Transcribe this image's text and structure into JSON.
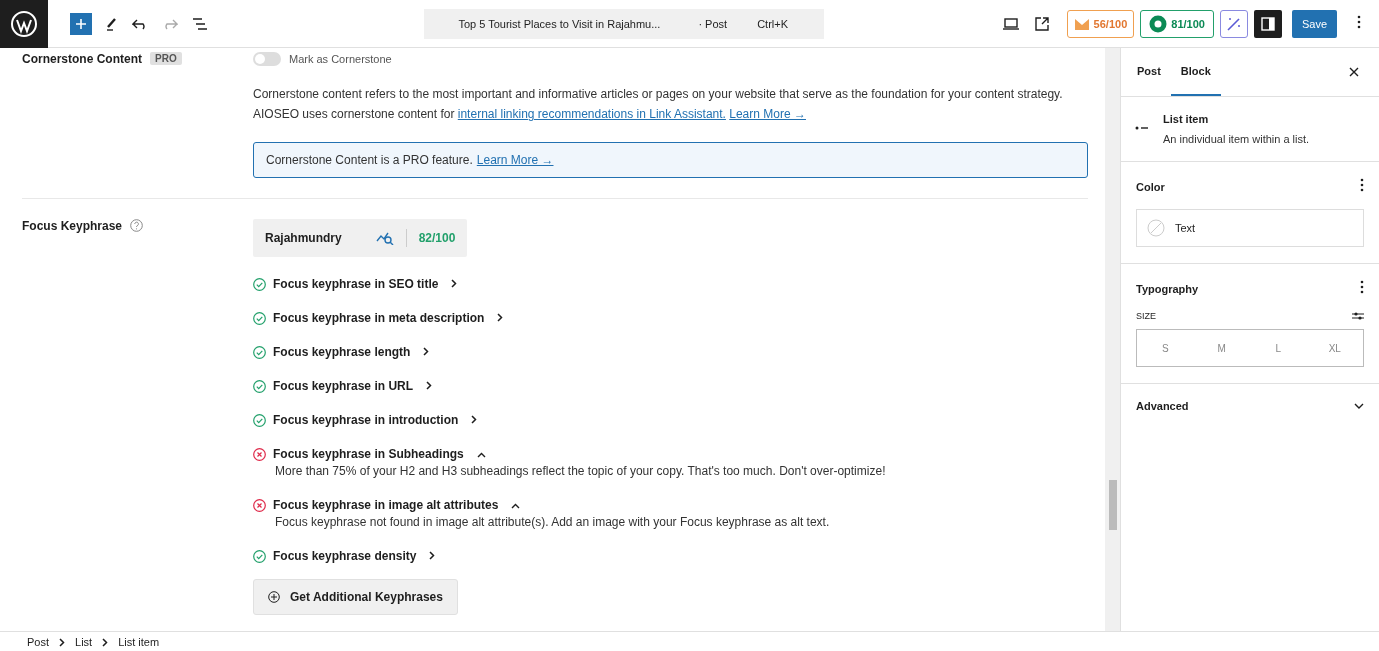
{
  "toolbar": {
    "document_title": "Top 5 Tourist Places to Visit in Rajahmu...",
    "post_type": "· Post",
    "shortcut": "Ctrl+K",
    "seo_score": "56/100",
    "aioseo_score": "81/100",
    "save": "Save"
  },
  "cornerstone": {
    "label": "Cornerstone Content",
    "badge": "PRO",
    "toggle_label": "Mark as Cornerstone",
    "on": false,
    "description": "Cornerstone content refers to the most important and informative articles or pages on your website that serve as the foundation for your content strategy. AIOSEO uses cornerstone content for",
    "link": "internal linking recommendations in Link Assistant.",
    "learn_more": "Learn More →",
    "notice": "Cornerstone Content is a PRO feature.",
    "notice_link": "Learn More →"
  },
  "focus": {
    "label": "Focus Keyphrase",
    "keyphrase": "Rajahmundry",
    "score": "82/100",
    "checks": [
      {
        "text": "Focus keyphrase in SEO title",
        "passed": true,
        "expanded": false
      },
      {
        "text": "Focus keyphrase in meta description",
        "passed": true,
        "expanded": false
      },
      {
        "text": "Focus keyphrase length",
        "passed": true,
        "expanded": false
      },
      {
        "text": "Focus keyphrase in URL",
        "passed": true,
        "expanded": false
      },
      {
        "text": "Focus keyphrase in introduction",
        "passed": true,
        "expanded": false
      },
      {
        "text": "Focus keyphrase in Subheadings",
        "passed": false,
        "expanded": true,
        "detail": "More than 75% of your H2 and H3 subheadings reflect the topic of your copy. That's too much. Don't over-optimize!"
      },
      {
        "text": "Focus keyphrase in image alt attributes",
        "passed": false,
        "expanded": true,
        "detail": "Focus keyphrase not found in image alt attribute(s). Add an image with your Focus keyphrase as alt text."
      },
      {
        "text": "Focus keyphrase density",
        "passed": true,
        "expanded": false
      }
    ],
    "add_button": "Get Additional Keyphrases"
  },
  "sidebar": {
    "tabs": [
      {
        "label": "Post",
        "selected": false
      },
      {
        "label": "Block",
        "selected": true
      }
    ],
    "block": {
      "name": "List item",
      "description": "An individual item within a list."
    },
    "color": {
      "title": "Color",
      "item": "Text"
    },
    "typography": {
      "title": "Typography",
      "size_label": "SIZE",
      "sizes": [
        "S",
        "M",
        "L",
        "XL"
      ]
    },
    "advanced": {
      "title": "Advanced",
      "expanded": false
    }
  },
  "breadcrumb": [
    "Post",
    "List",
    "List item"
  ]
}
